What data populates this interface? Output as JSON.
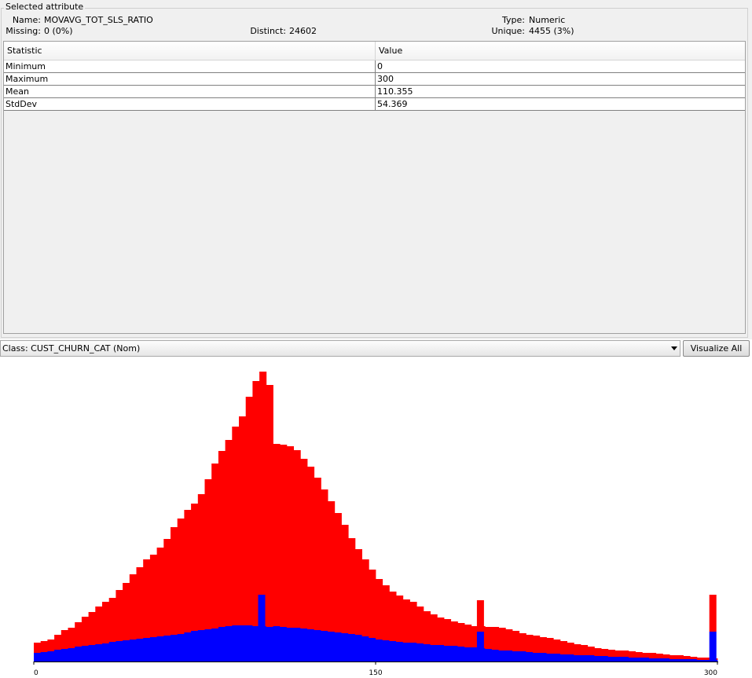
{
  "attribute_panel": {
    "title": "Selected attribute",
    "name_label": "Name:",
    "name_value": "MOVAVG_TOT_SLS_RATIO",
    "type_label": "Type:",
    "type_value": "Numeric",
    "missing_label": "Missing:",
    "missing_value": "0 (0%)",
    "distinct_label": "Distinct:",
    "distinct_value": "24602",
    "unique_label": "Unique:",
    "unique_value": "4455 (3%)"
  },
  "stats_table": {
    "headers": [
      "Statistic",
      "Value"
    ],
    "rows": [
      [
        "Minimum",
        "0"
      ],
      [
        "Maximum",
        "300"
      ],
      [
        "Mean",
        "110.355"
      ],
      [
        "StdDev",
        "54.369"
      ]
    ]
  },
  "class_selector": {
    "selected": "Class: CUST_CHURN_CAT (Nom)"
  },
  "visualize_all_label": "Visualize All",
  "colors": {
    "class_1": "#ff0000",
    "class_2": "#0000ff"
  },
  "chart_data": {
    "type": "bar",
    "stacked": true,
    "xlim": [
      0,
      300
    ],
    "tick_labels": [
      "0",
      "150",
      "300"
    ],
    "bin_heights": {
      "total": [
        24,
        26,
        28,
        34,
        40,
        43,
        50,
        57,
        63,
        70,
        76,
        81,
        91,
        100,
        111,
        120,
        130,
        136,
        145,
        156,
        171,
        182,
        193,
        201,
        213,
        232,
        252,
        268,
        282,
        299,
        312,
        337,
        357,
        369,
        352,
        277,
        276,
        274,
        269,
        258,
        248,
        234,
        219,
        204,
        189,
        174,
        157,
        143,
        130,
        117,
        105,
        97,
        89,
        84,
        79,
        76,
        70,
        64,
        60,
        56,
        54,
        51,
        49,
        47,
        45,
        45,
        44,
        44,
        43,
        41,
        39,
        36,
        34,
        33,
        31,
        30,
        28,
        26,
        24,
        22,
        21,
        19,
        17,
        16,
        15,
        14,
        14,
        13,
        12,
        11,
        11,
        10,
        9,
        8,
        8,
        7,
        6,
        5,
        5,
        4
      ],
      "blue": [
        11,
        12,
        13,
        15,
        16,
        17,
        19,
        20,
        21,
        22,
        23,
        25,
        26,
        27,
        28,
        29,
        30,
        31,
        32,
        33,
        34,
        35,
        37,
        39,
        40,
        41,
        42,
        44,
        45,
        46,
        46,
        46,
        45,
        45,
        44,
        45,
        44,
        43,
        43,
        42,
        41,
        40,
        39,
        38,
        37,
        36,
        35,
        34,
        32,
        30,
        28,
        27,
        26,
        25,
        24,
        24,
        23,
        22,
        21,
        21,
        20,
        20,
        19,
        18,
        18,
        17,
        16,
        15,
        14,
        14,
        13,
        13,
        12,
        11,
        11,
        10,
        10,
        9,
        9,
        8,
        8,
        8,
        7,
        7,
        6,
        6,
        6,
        5,
        5,
        5,
        4,
        4,
        4,
        3,
        3,
        3,
        3,
        2,
        2,
        2
      ],
      "units": "arbitrary (relative bin counts, unscaled)"
    },
    "spikes": [
      {
        "x": 100,
        "total": 350,
        "blue": 85
      },
      {
        "x": 196,
        "total": 78,
        "blue": 38
      },
      {
        "x": 298,
        "total": 85,
        "blue": 38
      }
    ]
  }
}
